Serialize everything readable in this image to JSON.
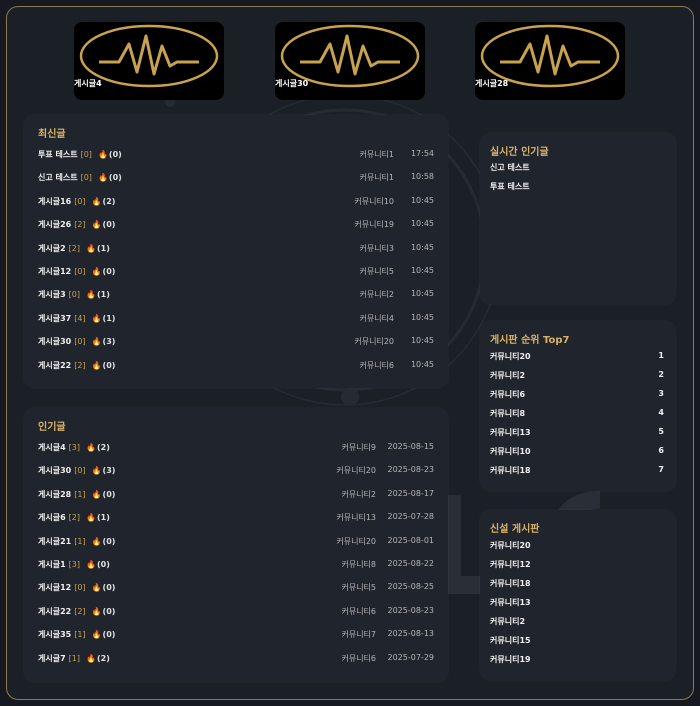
{
  "thumbnails": [
    {
      "label": "게시글4"
    },
    {
      "label": "게시글30"
    },
    {
      "label": "게시글28"
    }
  ],
  "recent": {
    "title": "최신글",
    "rows": [
      {
        "title": "투표 테스트",
        "count": "[0]",
        "likes": "(0)",
        "community": "커뮤니티1",
        "time": "17:54"
      },
      {
        "title": "신고 테스트",
        "count": "[0]",
        "likes": "(0)",
        "community": "커뮤니티1",
        "time": "10:58"
      },
      {
        "title": "게시글16",
        "count": "[0]",
        "likes": "(2)",
        "community": "커뮤니티10",
        "time": "10:45"
      },
      {
        "title": "게시글26",
        "count": "[2]",
        "likes": "(0)",
        "community": "커뮤니티19",
        "time": "10:45"
      },
      {
        "title": "게시글2",
        "count": "[2]",
        "likes": "(1)",
        "community": "커뮤니티3",
        "time": "10:45"
      },
      {
        "title": "게시글12",
        "count": "[0]",
        "likes": "(0)",
        "community": "커뮤니티5",
        "time": "10:45"
      },
      {
        "title": "게시글3",
        "count": "[0]",
        "likes": "(1)",
        "community": "커뮤니티2",
        "time": "10:45"
      },
      {
        "title": "게시글37",
        "count": "[4]",
        "likes": "(1)",
        "community": "커뮤니티4",
        "time": "10:45"
      },
      {
        "title": "게시글30",
        "count": "[0]",
        "likes": "(3)",
        "community": "커뮤니티20",
        "time": "10:45"
      },
      {
        "title": "게시글22",
        "count": "[2]",
        "likes": "(0)",
        "community": "커뮤니티6",
        "time": "10:45"
      }
    ]
  },
  "popular": {
    "title": "인기글",
    "rows": [
      {
        "title": "게시글4",
        "count": "[3]",
        "likes": "(2)",
        "community": "커뮤니티9",
        "date": "2025-08-15"
      },
      {
        "title": "게시글30",
        "count": "[0]",
        "likes": "(3)",
        "community": "커뮤니티20",
        "date": "2025-08-23"
      },
      {
        "title": "게시글28",
        "count": "[1]",
        "likes": "(0)",
        "community": "커뮤니티2",
        "date": "2025-08-17"
      },
      {
        "title": "게시글6",
        "count": "[2]",
        "likes": "(1)",
        "community": "커뮤니티13",
        "date": "2025-07-28"
      },
      {
        "title": "게시글21",
        "count": "[1]",
        "likes": "(0)",
        "community": "커뮤니티20",
        "date": "2025-08-01"
      },
      {
        "title": "게시글1",
        "count": "[3]",
        "likes": "(0)",
        "community": "커뮤니티8",
        "date": "2025-08-22"
      },
      {
        "title": "게시글12",
        "count": "[0]",
        "likes": "(0)",
        "community": "커뮤니티5",
        "date": "2025-08-25"
      },
      {
        "title": "게시글22",
        "count": "[2]",
        "likes": "(0)",
        "community": "커뮤니티6",
        "date": "2025-08-23"
      },
      {
        "title": "게시글35",
        "count": "[1]",
        "likes": "(0)",
        "community": "커뮤니티7",
        "date": "2025-08-13"
      },
      {
        "title": "게시글7",
        "count": "[1]",
        "likes": "(2)",
        "community": "커뮤니티6",
        "date": "2025-07-29"
      }
    ]
  },
  "realtime": {
    "title": "실시간 인기글",
    "items": [
      "신고 테스트",
      "투표 테스트"
    ]
  },
  "ranking": {
    "title": "게시판 순위 Top7",
    "items": [
      {
        "name": "커뮤니티20",
        "rank": "1"
      },
      {
        "name": "커뮤니티2",
        "rank": "2"
      },
      {
        "name": "커뮤니티6",
        "rank": "3"
      },
      {
        "name": "커뮤니티8",
        "rank": "4"
      },
      {
        "name": "커뮤니티13",
        "rank": "5"
      },
      {
        "name": "커뮤니티10",
        "rank": "6"
      },
      {
        "name": "커뮤니티18",
        "rank": "7"
      }
    ]
  },
  "new_boards": {
    "title": "신설 게시판",
    "items": [
      "커뮤니티20",
      "커뮤니티12",
      "커뮤니티18",
      "커뮤니티13",
      "커뮤니티2",
      "커뮤니티15",
      "커뮤니티19"
    ]
  },
  "colors": {
    "accent": "#d9b268",
    "panel": "#20242c",
    "background": "#1b1f26",
    "border": "#8a7a55"
  },
  "icons": {
    "likes": "fire-icon",
    "thumbnail": "waveform-logo-icon"
  }
}
